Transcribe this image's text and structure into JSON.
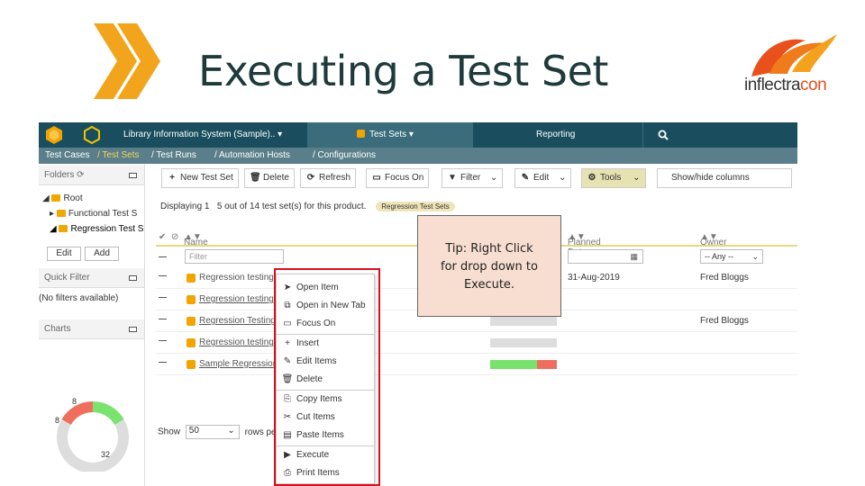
{
  "slide": {
    "title": "Executing a Test Set",
    "logo_part1": "inflectra",
    "logo_part2": "con",
    "colors": {
      "chevron": "#f2a41c",
      "title": "#1e3a3a",
      "logo_accent": "#e84d1c",
      "highlight_box": "#d4111b",
      "tip_bg": "#f7ded0"
    }
  },
  "topbar": {
    "product": "Library Information System (Sample)..",
    "section": "Test Sets",
    "reporting": "Reporting",
    "search_icon": "search-icon"
  },
  "subnav": {
    "items": [
      "Test Cases",
      "/ Test Sets",
      "/  Test Runs",
      "/  Automation Hosts",
      "/  Configurations"
    ]
  },
  "sidebar": {
    "folders": "Folders",
    "tree": [
      "Root",
      "Functional Test S",
      "Regression Test S"
    ],
    "edit": "Edit",
    "add": "Add",
    "quick_filter": "Quick Filter",
    "no_filters": "(No filters available)",
    "charts": "Charts",
    "donut": {
      "values": [
        8,
        8,
        32
      ],
      "labels": [
        "8",
        "8",
        "32"
      ],
      "colors": [
        "#ef6f5e",
        "#79e36d",
        "#dddddd"
      ]
    }
  },
  "toolbar": {
    "new_test_set": "New Test Set",
    "delete": "Delete",
    "refresh": "Refresh",
    "focus_on": "Focus On",
    "filter": "Filter",
    "edit": "Edit",
    "tools": "Tools",
    "show_hide": "Show/hide columns"
  },
  "grid": {
    "display_pre": "Displaying 1",
    "display_post": "5 out of 14 test set(s) for this product.",
    "badge": "Regression Test Sets",
    "headers": {
      "name": "Name",
      "planned_date": "Planned Date",
      "owner": "Owner"
    },
    "filter_placeholder": "Filter",
    "owner_filter": "-- Any --",
    "rows": [
      {
        "name": "Regression testing",
        "date": "31-Aug-2019",
        "owner": "Fred Bloggs"
      },
      {
        "name": "Regression testing f",
        "date": "",
        "owner": ""
      },
      {
        "name": "Regression Testing f",
        "date": "",
        "owner": "Fred Bloggs"
      },
      {
        "name": "Regression testing f",
        "date": "",
        "owner": ""
      },
      {
        "name": "Sample Regression",
        "date": "",
        "owner": ""
      }
    ],
    "last_row_progress": {
      "pass": 0.7,
      "fail": 0.3
    },
    "show": "Show",
    "page_size": "50",
    "rows_per": "rows pe"
  },
  "context_menu": {
    "items": [
      "Open Item",
      "Open in New Tab",
      "Focus On",
      "Insert",
      "Edit Items",
      "Delete",
      "Copy Items",
      "Cut Items",
      "Paste Items",
      "Execute",
      "Print Items"
    ]
  },
  "tip": {
    "line1": "Tip:  Right Click",
    "line2": "for drop down to",
    "line3": "Execute."
  }
}
